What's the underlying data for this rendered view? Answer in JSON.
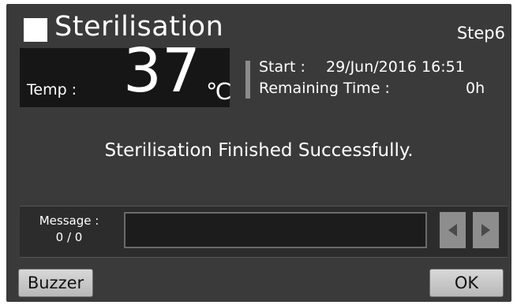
{
  "header": {
    "title": "Sterilisation",
    "step": "Step6"
  },
  "temperature": {
    "label": "Temp :",
    "value": "37",
    "unit": "℃"
  },
  "info": {
    "start_label": "Start :",
    "start_value": "29/Jun/2016 16:51",
    "remaining_label": "Remaining Time :",
    "remaining_value": "0h"
  },
  "status_message": "Sterilisation Finished Successfully.",
  "message_panel": {
    "label": "Message :",
    "count": "0 / 0",
    "text": ""
  },
  "buttons": {
    "buzzer": "Buzzer",
    "ok": "OK"
  },
  "icons": {
    "prev": "triangle-left-icon",
    "next": "triangle-right-icon"
  },
  "colors": {
    "panel_bg": "#3a3a3a",
    "temp_panel_bg": "#161616",
    "nav_button": "#8d8d8d",
    "text": "#ffffff"
  }
}
